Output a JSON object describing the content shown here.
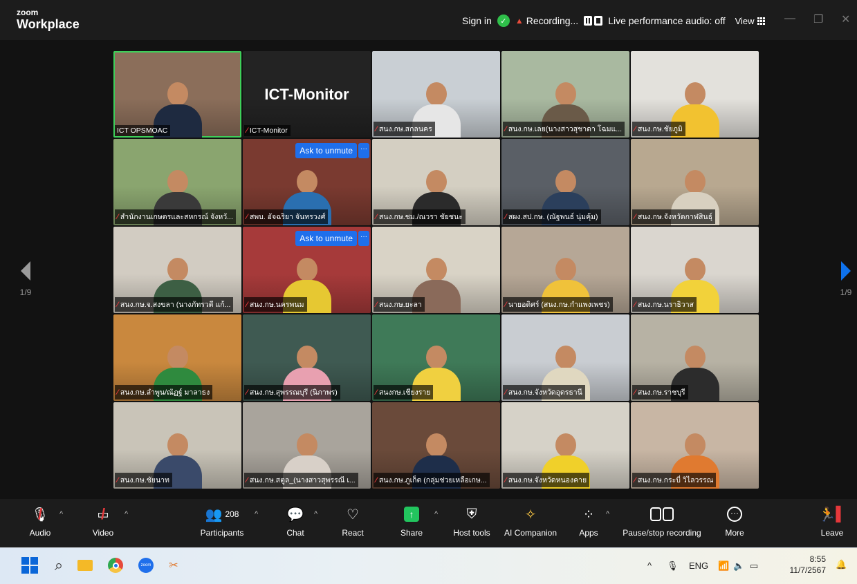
{
  "titlebar": {
    "brand_top": "zoom",
    "brand_bottom": "Workplace",
    "sign_in": "Sign in",
    "recording": "Recording...",
    "live_audio": "Live performance audio: off",
    "view": "View"
  },
  "gallery": {
    "page_left": "1/9",
    "page_right": "1/9",
    "ask_to_unmute": "Ask to unmute",
    "more": "···",
    "monitor_title": "ICT-Monitor",
    "tiles": [
      {
        "name": "ICT OPSMOAC",
        "bg": "#8b6e5a",
        "shirt": "#1e2a40",
        "muted": false
      },
      {
        "name": "ICT-Monitor",
        "bg": "#232323",
        "shirt": "",
        "muted": true
      },
      {
        "name": "สนง.กษ.สกลนคร",
        "bg": "#c9cfd4",
        "shirt": "#e6e6e6",
        "muted": true
      },
      {
        "name": "สนง.กษ.เลย(นางสาวสุชาดา โฉมแ...",
        "bg": "#a9b9a0",
        "shirt": "#6a5a48",
        "muted": true
      },
      {
        "name": "สนง.กษ.ชัยภูมิ",
        "bg": "#e3e1dc",
        "shirt": "#f2c230",
        "muted": true
      },
      {
        "name": "สำนักงานเกษตรและสหกรณ์ จังหวั...",
        "bg": "#8aa56f",
        "shirt": "#3a3a3a",
        "muted": true
      },
      {
        "name": "สพบ. อัจฉริยา จันทรวงศ์",
        "bg": "#7a3a30",
        "shirt": "#2a6fb0",
        "muted": true
      },
      {
        "name": "สนง.กษ.ชม./ณวรา ชัยชนะ",
        "bg": "#d4cfc2",
        "shirt": "#2b2b2b",
        "muted": true
      },
      {
        "name": "สผง.สป.กษ. (ณัฐพนธ์ นุ่มคุ้ม)",
        "bg": "#5a5f66",
        "shirt": "#2b3f5c",
        "muted": true
      },
      {
        "name": "สนง.กษ.จังหวัดกาฬสินธุ์",
        "bg": "#b8a890",
        "shirt": "#d8d0c0",
        "muted": true
      },
      {
        "name": "สนง.กษ.จ.สงขลา (นางภัทรวดี แก้...",
        "bg": "#d2ccc2",
        "shirt": "#3d5f44",
        "muted": true
      },
      {
        "name": "สนง.กษ.นครพนม",
        "bg": "#a63a3a",
        "shirt": "#e6c832",
        "muted": true
      },
      {
        "name": "สนง.กษ.ยะลา",
        "bg": "#d9d3c6",
        "shirt": "#8a6a5a",
        "muted": true
      },
      {
        "name": "นายอดิศร์ (สนง.กษ.กำแพงเพชร)",
        "bg": "#b6a796",
        "shirt": "#f0c23a",
        "muted": true
      },
      {
        "name": "สนง.กษ.นราธิวาส",
        "bg": "#dad6cf",
        "shirt": "#f2d23a",
        "muted": true
      },
      {
        "name": "สนง.กษ.ลำพูน/ณัฏฐ์ มาลาธง",
        "bg": "#c9883e",
        "shirt": "#2f8a3e",
        "muted": true
      },
      {
        "name": "สนง.กษ.สุพรรณบุรี (นิภาพร)",
        "bg": "#3f5a52",
        "shirt": "#e8a0b0",
        "muted": true
      },
      {
        "name": "สนงกษ.เชียงราย",
        "bg": "#3f7a58",
        "shirt": "#f0d040",
        "muted": true
      },
      {
        "name": "สนง.กษ.จังหวัดอุดรธานี",
        "bg": "#c9cdd2",
        "shirt": "#e0d8c0",
        "muted": true
      },
      {
        "name": "สนง.กษ.ราชบุรี",
        "bg": "#b7b2a4",
        "shirt": "#2c2c2c",
        "muted": true
      },
      {
        "name": "สนง.กษ.ชัยนาท",
        "bg": "#c9c4b8",
        "shirt": "#3a4a6a",
        "muted": true
      },
      {
        "name": "สนง.กษ.สตูล_(นางสาวสุพรรณี เ...",
        "bg": "#a9a49c",
        "shirt": "#d8d0c8",
        "muted": true
      },
      {
        "name": "สนง.กษ.ภูเก็ต (กลุ่มช่วยเหลือเกษ...",
        "bg": "#6a4a3a",
        "shirt": "#1e2e4a",
        "muted": true
      },
      {
        "name": "สนง.กษ.จังหวัดหนองคาย",
        "bg": "#d6d2c8",
        "shirt": "#f0d02a",
        "muted": true
      },
      {
        "name": "สนง.กษ.กระบี่ วิไลวรรณ",
        "bg": "#c8b6a4",
        "shirt": "#e07a30",
        "muted": true
      }
    ]
  },
  "toolbar": {
    "audio": "Audio",
    "video": "Video",
    "participants": "Participants",
    "participants_count": "208",
    "chat": "Chat",
    "react": "React",
    "share": "Share",
    "host_tools": "Host tools",
    "ai_companion": "AI Companion",
    "apps": "Apps",
    "pause_recording": "Pause/stop recording",
    "more": "More",
    "leave": "Leave"
  },
  "taskbar": {
    "language": "ENG",
    "time": "8:55",
    "date": "11/7/2567"
  },
  "colors": {
    "active_border": "#3ecf5a",
    "accent_blue": "#0e72ed",
    "muted_red": "#e5383b",
    "share_green": "#22c55e"
  }
}
